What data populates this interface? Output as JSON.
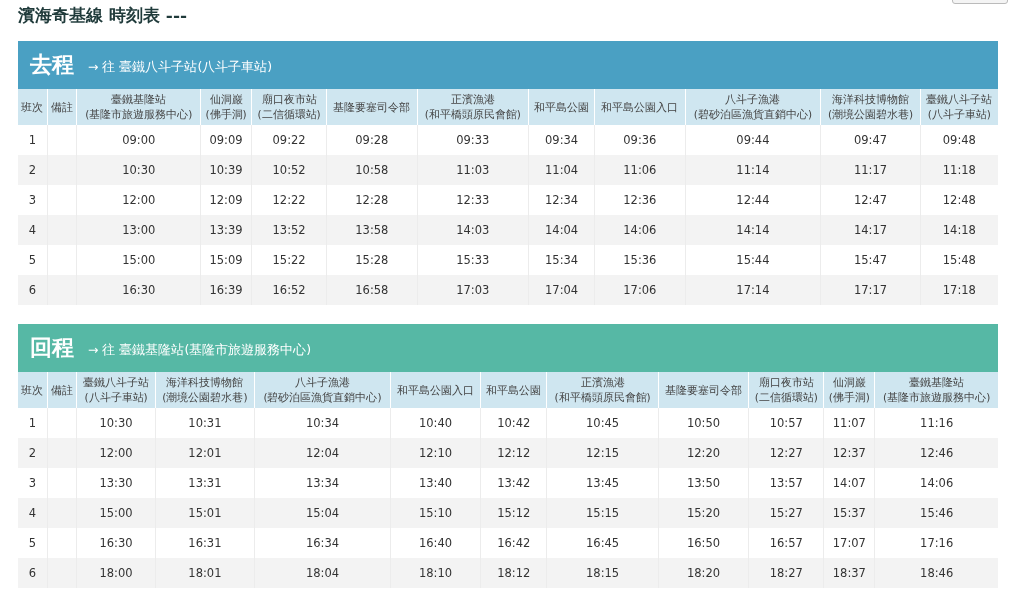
{
  "title": "濱海奇基線 時刻表 ---",
  "sections": [
    {
      "label": "去程",
      "destination": "→ 往 臺鐵八斗子站(八斗子車站)",
      "color": "#4aa0c3",
      "columns": [
        {
          "name": "班次"
        },
        {
          "name": "備註"
        },
        {
          "name": "臺鐵基隆站",
          "sub": "(基隆市旅遊服務中心)"
        },
        {
          "name": "仙洞巖",
          "sub": "(佛手洞)"
        },
        {
          "name": "廟口夜市站",
          "sub": "(二信循環站)"
        },
        {
          "name": "基隆要塞司令部"
        },
        {
          "name": "正濱漁港",
          "sub": "(和平橋頭原民會館)"
        },
        {
          "name": "和平島公園"
        },
        {
          "name": "和平島公園入口"
        },
        {
          "name": "八斗子漁港",
          "sub": "(碧砂泊區漁貨直銷中心)"
        },
        {
          "name": "海洋科技博物館",
          "sub": "(潮境公園碧水巷)"
        },
        {
          "name": "臺鐵八斗子站",
          "sub": "(八斗子車站)"
        }
      ],
      "rows": [
        {
          "no": "1",
          "times": [
            "09:00",
            "09:09",
            "09:22",
            "09:28",
            "09:33",
            "09:34",
            "09:36",
            "09:44",
            "09:47",
            "09:48"
          ]
        },
        {
          "no": "2",
          "times": [
            "10:30",
            "10:39",
            "10:52",
            "10:58",
            "11:03",
            "11:04",
            "11:06",
            "11:14",
            "11:17",
            "11:18"
          ]
        },
        {
          "no": "3",
          "times": [
            "12:00",
            "12:09",
            "12:22",
            "12:28",
            "12:33",
            "12:34",
            "12:36",
            "12:44",
            "12:47",
            "12:48"
          ]
        },
        {
          "no": "4",
          "times": [
            "13:00",
            "13:39",
            "13:52",
            "13:58",
            "14:03",
            "14:04",
            "14:06",
            "14:14",
            "14:17",
            "14:18"
          ]
        },
        {
          "no": "5",
          "times": [
            "15:00",
            "15:09",
            "15:22",
            "15:28",
            "15:33",
            "15:34",
            "15:36",
            "15:44",
            "15:47",
            "15:48"
          ]
        },
        {
          "no": "6",
          "times": [
            "16:30",
            "16:39",
            "16:52",
            "16:58",
            "17:03",
            "17:04",
            "17:06",
            "17:14",
            "17:17",
            "17:18"
          ]
        }
      ]
    },
    {
      "label": "回程",
      "destination": "→ 往 臺鐵基隆站(基隆市旅遊服務中心)",
      "color": "#56b8a5",
      "columns": [
        {
          "name": "班次"
        },
        {
          "name": "備註"
        },
        {
          "name": "臺鐵八斗子站",
          "sub": "(八斗子車站)"
        },
        {
          "name": "海洋科技博物館",
          "sub": "(潮境公園碧水巷)"
        },
        {
          "name": "八斗子漁港",
          "sub": "(碧砂泊區漁貨直銷中心)"
        },
        {
          "name": "和平島公園入口"
        },
        {
          "name": "和平島公園"
        },
        {
          "name": "正濱漁港",
          "sub": "(和平橋頭原民會館)"
        },
        {
          "name": "基隆要塞司令部"
        },
        {
          "name": "廟口夜市站",
          "sub": "(二信循環站)"
        },
        {
          "name": "仙洞巖",
          "sub": "(佛手洞)"
        },
        {
          "name": "臺鐵基隆站",
          "sub": "(基隆市旅遊服務中心)"
        }
      ],
      "rows": [
        {
          "no": "1",
          "times": [
            "10:30",
            "10:31",
            "10:34",
            "10:40",
            "10:42",
            "10:45",
            "10:50",
            "10:57",
            "11:07",
            "11:16"
          ]
        },
        {
          "no": "2",
          "times": [
            "12:00",
            "12:01",
            "12:04",
            "12:10",
            "12:12",
            "12:15",
            "12:20",
            "12:27",
            "12:37",
            "12:46"
          ]
        },
        {
          "no": "3",
          "times": [
            "13:30",
            "13:31",
            "13:34",
            "13:40",
            "13:42",
            "13:45",
            "13:50",
            "13:57",
            "14:07",
            "14:06"
          ]
        },
        {
          "no": "4",
          "times": [
            "15:00",
            "15:01",
            "15:04",
            "15:10",
            "15:12",
            "15:15",
            "15:20",
            "15:27",
            "15:37",
            "15:46"
          ]
        },
        {
          "no": "5",
          "times": [
            "16:30",
            "16:31",
            "16:34",
            "16:40",
            "16:42",
            "16:45",
            "16:50",
            "16:57",
            "17:07",
            "17:16"
          ]
        },
        {
          "no": "6",
          "times": [
            "18:00",
            "18:01",
            "18:04",
            "18:10",
            "18:12",
            "18:15",
            "18:20",
            "18:27",
            "18:37",
            "18:46"
          ]
        }
      ]
    }
  ]
}
